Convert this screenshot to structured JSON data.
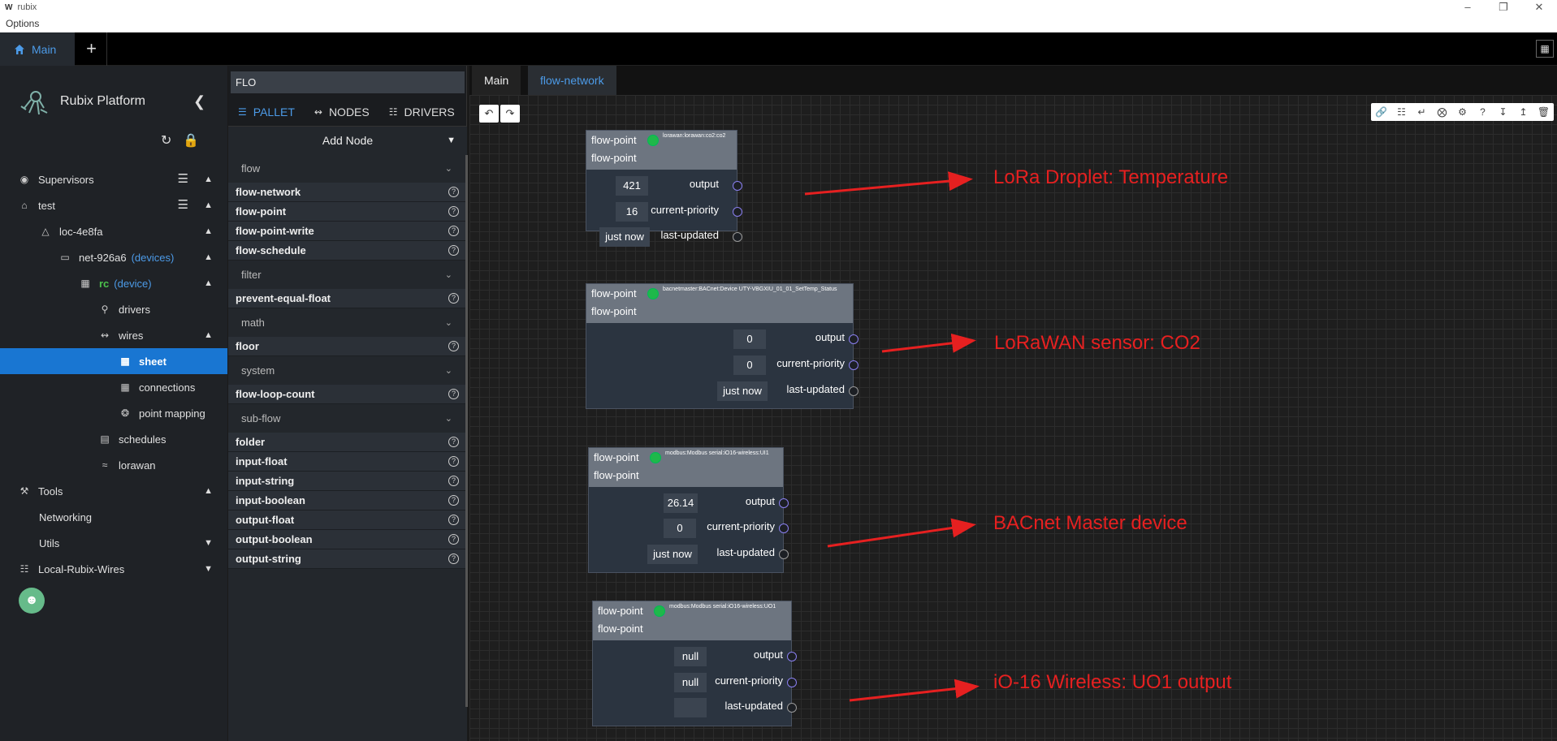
{
  "window": {
    "title": "rubix",
    "app_icon": "W",
    "menu": "Options"
  },
  "topbar": {
    "main_tab": "Main",
    "plus": "+"
  },
  "sidebar": {
    "brand": "Rubix Platform",
    "tree": [
      {
        "label": "Supervisors",
        "icon": "eye-icon"
      },
      {
        "label": "test",
        "icon": "home-icon"
      },
      {
        "label": "loc-4e8fa",
        "icon": "warning-icon"
      },
      {
        "label": "net-926a6",
        "sub": "(devices)",
        "icon": "laptop-icon"
      },
      {
        "label": "rc",
        "sub": "(device)",
        "icon": "device-icon"
      },
      {
        "label": "drivers",
        "icon": "plug-icon"
      },
      {
        "label": "wires",
        "icon": "wires-icon"
      },
      {
        "label": "sheet",
        "icon": "sheet-icon"
      },
      {
        "label": "connections",
        "icon": "connections-icon"
      },
      {
        "label": "point mapping",
        "icon": "mapping-icon"
      },
      {
        "label": "schedules",
        "icon": "calendar-icon"
      },
      {
        "label": "lorawan",
        "icon": "wifi-icon"
      },
      {
        "label": "Tools",
        "icon": "wrench-icon"
      },
      {
        "label": "Networking"
      },
      {
        "label": "Utils"
      },
      {
        "label": "Local-Rubix-Wires",
        "icon": "hierarchy-icon"
      }
    ]
  },
  "palette": {
    "search": "FLO",
    "tabs": [
      "PALLET",
      "NODES",
      "DRIVERS"
    ],
    "add_node": "Add Node",
    "sections": [
      {
        "category": "flow",
        "items": [
          "flow-network",
          "flow-point",
          "flow-point-write",
          "flow-schedule"
        ]
      },
      {
        "category": "filter",
        "items": [
          "prevent-equal-float"
        ]
      },
      {
        "category": "math",
        "items": [
          "floor"
        ]
      },
      {
        "category": "system",
        "items": [
          "flow-loop-count"
        ]
      },
      {
        "category": "sub-flow",
        "items": [
          "folder",
          "input-float",
          "input-string",
          "input-boolean",
          "output-float",
          "output-boolean",
          "output-string"
        ]
      }
    ]
  },
  "canvas": {
    "tabs": [
      "Main",
      "flow-network"
    ],
    "nodes": [
      {
        "title": "flow-point",
        "subtitle": "flow-point",
        "source": "lorawan:lorawan:co2:co2",
        "values": [
          "421",
          "16",
          "just now"
        ],
        "ports": [
          "output",
          "current-priority",
          "last-updated"
        ]
      },
      {
        "title": "flow-point",
        "subtitle": "flow-point",
        "source": "bacnetmaster:BACnet:Device UTY-VBGXIU_01_01_SetTemp_Status",
        "values": [
          "0",
          "0",
          "just now"
        ],
        "ports": [
          "output",
          "current-priority",
          "last-updated"
        ]
      },
      {
        "title": "flow-point",
        "subtitle": "flow-point",
        "source": "modbus:Modbus serial:iO16-wireless:UI1",
        "values": [
          "26.14",
          "0",
          "just now"
        ],
        "ports": [
          "output",
          "current-priority",
          "last-updated"
        ]
      },
      {
        "title": "flow-point",
        "subtitle": "flow-point",
        "source": "modbus:Modbus serial:iO16-wireless:UO1",
        "values": [
          "null",
          "null",
          ""
        ],
        "ports": [
          "output",
          "current-priority",
          "last-updated"
        ]
      }
    ],
    "annotations": [
      "LoRa Droplet: Temperature",
      "LoRaWAN sensor: CO2",
      "BACnet Master device",
      "iO-16 Wireless: UO1 output"
    ],
    "annotation_color": "#e62020"
  }
}
